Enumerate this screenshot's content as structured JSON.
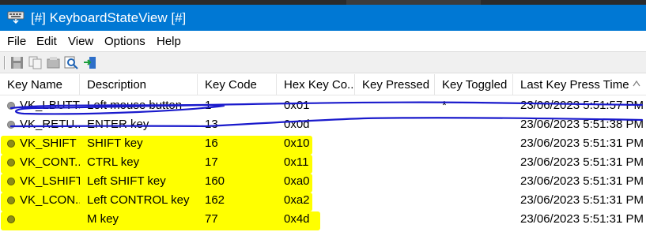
{
  "window": {
    "title": "[#] KeyboardStateView [#]"
  },
  "menu": {
    "items": [
      "File",
      "Edit",
      "View",
      "Options",
      "Help"
    ]
  },
  "toolbar": {
    "buttons": [
      "save-icon",
      "copy-icon",
      "properties-icon",
      "find-icon",
      "exit-icon"
    ]
  },
  "table": {
    "columns": [
      "Key Name",
      "Description",
      "Key Code",
      "Hex Key Co...",
      "Key Pressed",
      "Key Toggled",
      "Last Key Press Time"
    ],
    "rows": [
      {
        "key_name": "VK_LBUTT...",
        "description": "Left mouse button",
        "key_code": "1",
        "hex": "0x01",
        "pressed": "",
        "toggled": "*",
        "time": "23/06/2023 5:51:57 PM"
      },
      {
        "key_name": "VK_RETU...",
        "description": "ENTER key",
        "key_code": "13",
        "hex": "0x0d",
        "pressed": "",
        "toggled": "",
        "time": "23/06/2023 5:51:38 PM"
      },
      {
        "key_name": "VK_SHIFT",
        "description": "SHIFT key",
        "key_code": "16",
        "hex": "0x10",
        "pressed": "",
        "toggled": "",
        "time": "23/06/2023 5:51:31 PM"
      },
      {
        "key_name": "VK_CONT...",
        "description": "CTRL key",
        "key_code": "17",
        "hex": "0x11",
        "pressed": "",
        "toggled": "",
        "time": "23/06/2023 5:51:31 PM"
      },
      {
        "key_name": "VK_LSHIFT",
        "description": "Left SHIFT key",
        "key_code": "160",
        "hex": "0xa0",
        "pressed": "",
        "toggled": "",
        "time": "23/06/2023 5:51:31 PM"
      },
      {
        "key_name": "VK_LCON...",
        "description": "Left CONTROL key",
        "key_code": "162",
        "hex": "0xa2",
        "pressed": "",
        "toggled": "",
        "time": "23/06/2023 5:51:31 PM"
      },
      {
        "key_name": "",
        "description": "M key",
        "key_code": "77",
        "hex": "0x4d",
        "pressed": "",
        "toggled": "",
        "time": "23/06/2023 5:51:31 PM"
      }
    ]
  },
  "colors": {
    "titlebar": "#0078d4",
    "highlight": "#ffff00",
    "annotation_ink": "#1a1acc"
  }
}
